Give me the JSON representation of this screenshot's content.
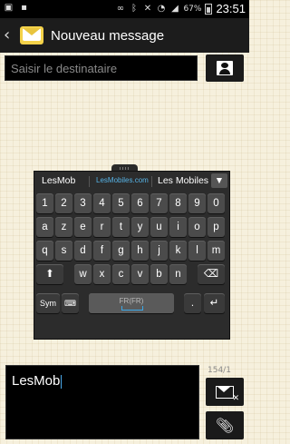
{
  "status_bar": {
    "battery_pct": "67%",
    "time": "23:51",
    "icons": [
      "image-icon",
      "notification-icon",
      "voicemail-icon",
      "bluetooth-icon",
      "mute-icon",
      "wifi-icon",
      "signal-icon",
      "battery-icon"
    ]
  },
  "action_bar": {
    "title": "Nouveau message"
  },
  "recipient": {
    "placeholder": "Saisir le destinataire"
  },
  "keyboard": {
    "suggestions": [
      "LesMob",
      "LesMobiles.com",
      "Les Mobiles"
    ],
    "row_numbers": [
      "1",
      "2",
      "3",
      "4",
      "5",
      "6",
      "7",
      "8",
      "9",
      "0"
    ],
    "row1": [
      "a",
      "z",
      "e",
      "r",
      "t",
      "y",
      "u",
      "i",
      "o",
      "p"
    ],
    "row2": [
      "q",
      "s",
      "d",
      "f",
      "g",
      "h",
      "j",
      "k",
      "l",
      "m"
    ],
    "row3": [
      "w",
      "x",
      "c",
      "v",
      "b",
      "n"
    ],
    "sym_label": "Sym",
    "space_label": "FR(FR)",
    "enter_label": "↵",
    "shift_label": "⬆",
    "backspace_label": "⌫"
  },
  "compose": {
    "text": "LesMob",
    "counter": "154/1"
  }
}
